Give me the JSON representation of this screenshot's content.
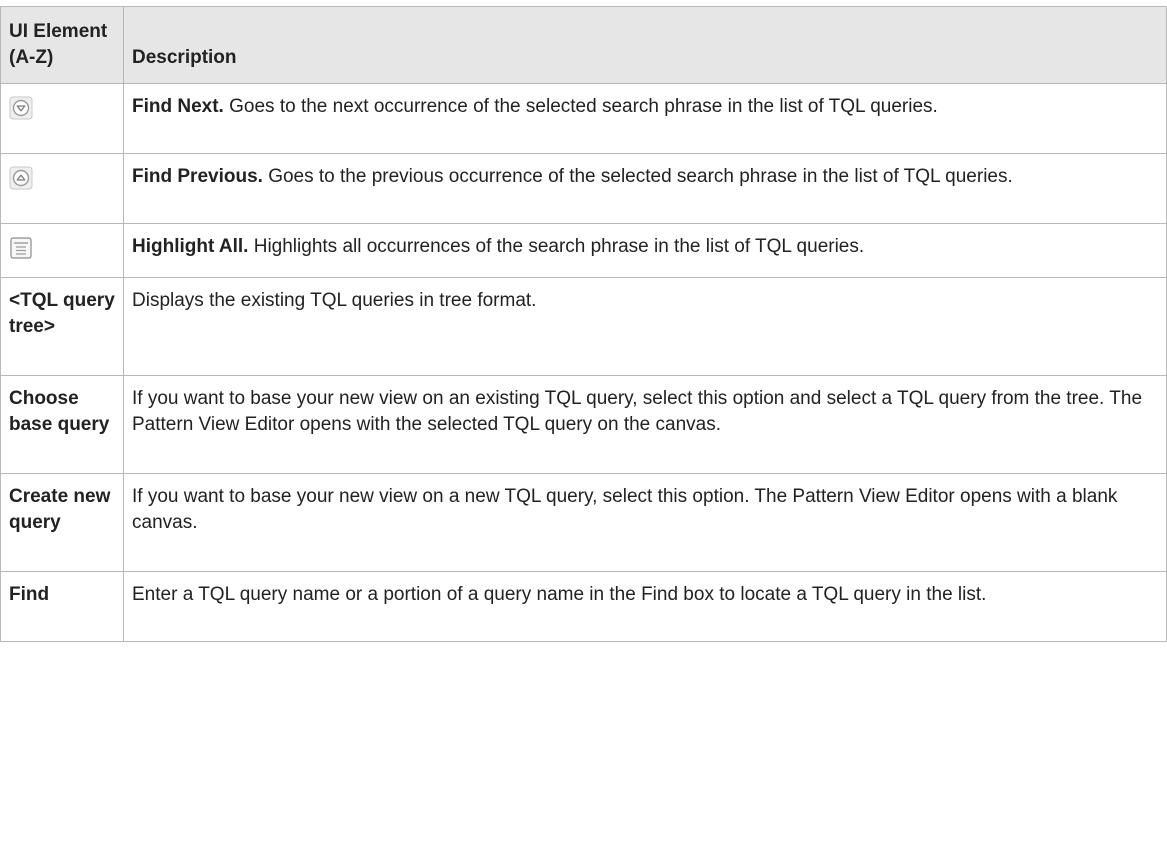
{
  "table": {
    "headers": [
      "UI Element (A-Z)",
      "Description"
    ],
    "rows": [
      {
        "element": "",
        "icon": "find-next-icon",
        "lead": "Find Next.",
        "text": " Goes to the next occurrence of the selected search phrase in the list of TQL queries."
      },
      {
        "element": "",
        "icon": "find-previous-icon",
        "lead": "Find Previous.",
        "text": " Goes to the previous occurrence of the selected search phrase in the list of TQL queries."
      },
      {
        "element": "",
        "icon": "highlight-all-icon",
        "lead": "Highlight All.",
        "text": " Highlights all occurrences of the search phrase in the list of TQL queries."
      },
      {
        "element": "<TQL query tree>",
        "icon": "",
        "lead": "",
        "text": "Displays the existing TQL queries in tree format."
      },
      {
        "element": "Choose base query",
        "icon": "",
        "lead": "",
        "text": "If you want to base your new view on an existing TQL query, select this option and select a TQL query from the tree. The Pattern View Editor opens with the selected TQL query on the canvas."
      },
      {
        "element": "Create new query",
        "icon": "",
        "lead": "",
        "text": "If you want to base your new view on a new TQL query, select this option. The Pattern View Editor opens with a blank canvas."
      },
      {
        "element": "Find",
        "icon": "",
        "lead": "",
        "text": "Enter a TQL query name or a portion of a query name in the Find box to locate a TQL query in the list."
      }
    ]
  }
}
